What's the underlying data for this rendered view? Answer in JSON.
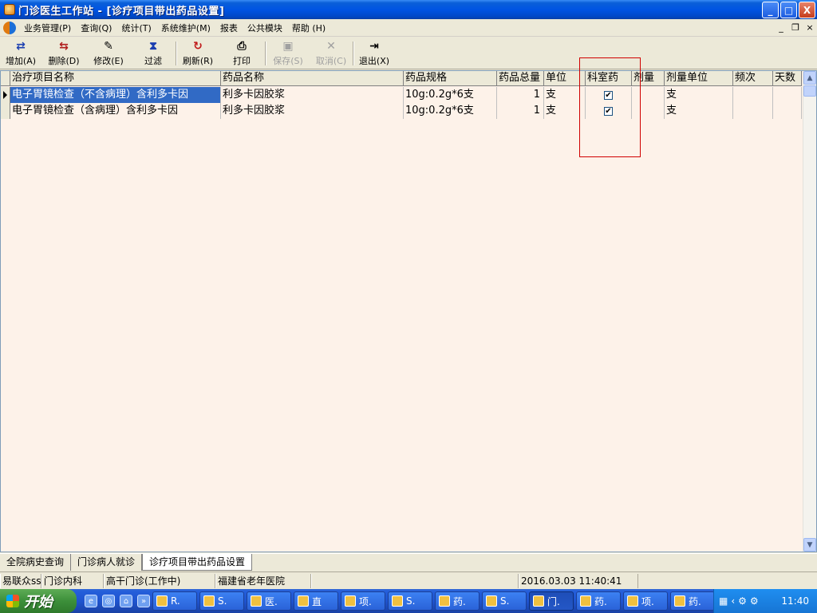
{
  "window": {
    "title": "门诊医生工作站 - [诊疗项目带出药品设置]",
    "buttons": {
      "minimize": "_",
      "maximize": "□",
      "close": "X"
    }
  },
  "menu": {
    "items": [
      "业务管理(P)",
      "查询(Q)",
      "统计(T)",
      "系统维护(M)",
      "报表",
      "公共模块",
      "帮助 (H)"
    ],
    "mdi": {
      "minimize": "_",
      "restore": "❐",
      "close": "×"
    }
  },
  "toolbar": {
    "buttons": [
      {
        "label": "增加(A)",
        "icon": "⇄",
        "enabled": true
      },
      {
        "label": "删除(D)",
        "icon": "⇆",
        "enabled": true
      },
      {
        "label": "修改(E)",
        "icon": "✎",
        "enabled": true
      },
      {
        "label": "过滤",
        "icon": "⧗",
        "enabled": true
      },
      {
        "label": "刷新(R)",
        "icon": "↻",
        "enabled": true
      },
      {
        "label": "打印",
        "icon": "⎙",
        "enabled": true
      },
      {
        "label": "保存(S)",
        "icon": "▣",
        "enabled": false
      },
      {
        "label": "取消(C)",
        "icon": "✕",
        "enabled": false
      },
      {
        "label": "退出(X)",
        "icon": "⇥",
        "enabled": true
      }
    ]
  },
  "grid": {
    "columns": [
      "治疗项目名称",
      "药品名称",
      "药品规格",
      "药品总量",
      "单位",
      "科室药",
      "剂量",
      "剂量单位",
      "频次",
      "天数"
    ],
    "rows": [
      {
        "item": "电子胃镜检查（不含病理）含利多卡因",
        "drug": "利多卡因胶浆",
        "spec": "10g:0.2g*6支",
        "total": "1",
        "unit": "支",
        "dept_drug": "✔",
        "dose": "",
        "dose_unit": "支",
        "freq": "",
        "days": ""
      },
      {
        "item": "电子胃镜检查（含病理）含利多卡因",
        "drug": "利多卡因胶浆",
        "spec": "10g:0.2g*6支",
        "total": "1",
        "unit": "支",
        "dept_drug": "✔",
        "dose": "",
        "dose_unit": "支",
        "freq": "",
        "days": ""
      }
    ],
    "scroll": {
      "up": "▲",
      "down": "▼"
    }
  },
  "tabs": [
    "全院病史查询",
    "门诊病人就诊",
    "诊疗项目带出药品设置"
  ],
  "statusbar": {
    "user": "易联众ss",
    "dept": "门诊内科",
    "room": "高干门诊(工作中)",
    "hospital": "福建省老年医院",
    "blank": "",
    "datetime": "2016.03.03 11:40:41"
  },
  "taskbar": {
    "start": "开始",
    "quick_launch": [
      "e",
      "◎",
      "⌂",
      "»"
    ],
    "tasks": [
      "R.",
      "S.",
      "医.",
      "直",
      "项.",
      "S.",
      "药.",
      "S.",
      "门.",
      "药.",
      "项.",
      "药."
    ],
    "tray": {
      "icons": [
        "▦",
        "‹",
        "⚙",
        "⚙"
      ],
      "time": "11:40"
    }
  }
}
